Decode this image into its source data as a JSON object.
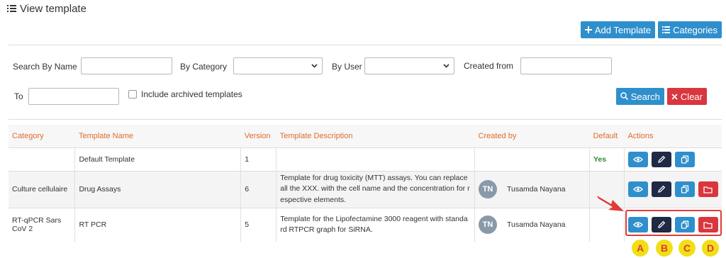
{
  "header": {
    "title": "View template",
    "title_icon": "list-icon"
  },
  "top_buttons": {
    "add_template": "Add Template",
    "categories": "Categories"
  },
  "filters": {
    "search_by_name_label": "Search By Name",
    "by_category_label": "By Category",
    "by_user_label": "By User",
    "created_from_label": "Created from",
    "to_label": "To",
    "include_archived_label": "Include archived templates",
    "search_button": "Search",
    "clear_button": "Clear"
  },
  "table": {
    "headers": {
      "category": "Category",
      "template_name": "Template Name",
      "version": "Version",
      "description": "Template Description",
      "created_by": "Created by",
      "default": "Default",
      "actions": "Actions"
    },
    "rows": [
      {
        "category": "",
        "name": "Default Template",
        "version": "1",
        "description": "",
        "creator": "",
        "avatar": "",
        "default": "Yes"
      },
      {
        "category": "Culture cellulaire",
        "name": "Drug Assays",
        "version": "6",
        "description": "Template for drug toxicity (MTT) assays. You can replace all the XXX. with the cell name and the concentration for r espective elements.",
        "creator": "Tusamda Nayana",
        "avatar": "TN",
        "default": ""
      },
      {
        "category": "RT-qPCR Sars CoV 2",
        "name": "RT PCR",
        "version": "5",
        "description": "Template for the Lipofectamine 3000 reagent with standa rd RTPCR graph for SiRNA.",
        "creator": "Tusamda Nayana",
        "avatar": "TN",
        "default": ""
      }
    ]
  },
  "annotations": {
    "a": "A",
    "b": "B",
    "c": "C",
    "d": "D"
  },
  "colors": {
    "primary": "#2f8fcc",
    "danger": "#d9363e",
    "dark": "#1f2a44",
    "header_text": "#e06b2b",
    "success": "#2e8b2e",
    "badge": "#f1df16"
  }
}
